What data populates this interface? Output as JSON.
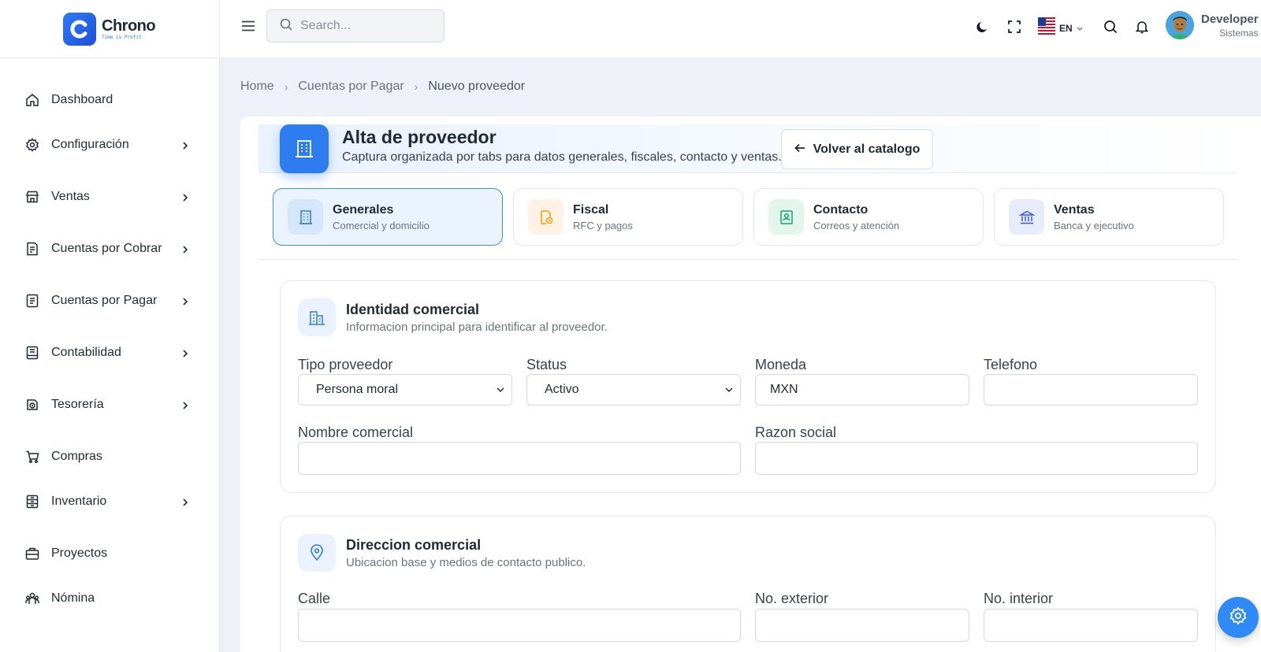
{
  "app": {
    "name": "Chrono",
    "tagline": "Time is Profit"
  },
  "topbar": {
    "search_placeholder": "Search...",
    "language": "EN",
    "user_name": "Developer",
    "user_role": "Sistemas"
  },
  "sidebar": {
    "items": [
      {
        "label": "Dashboard",
        "icon": "home-icon",
        "has_children": false
      },
      {
        "label": "Configuración",
        "icon": "gear-icon",
        "has_children": true
      },
      {
        "label": "Ventas",
        "icon": "store-icon",
        "has_children": true
      },
      {
        "label": "Cuentas por Cobrar",
        "icon": "receipt-icon",
        "has_children": true
      },
      {
        "label": "Cuentas por Pagar",
        "icon": "document-icon",
        "has_children": true
      },
      {
        "label": "Contabilidad",
        "icon": "ledger-icon",
        "has_children": true
      },
      {
        "label": "Tesorería",
        "icon": "coins-icon",
        "has_children": true
      },
      {
        "label": "Compras",
        "icon": "cart-icon",
        "has_children": false
      },
      {
        "label": "Inventario",
        "icon": "inventory-icon",
        "has_children": true
      },
      {
        "label": "Proyectos",
        "icon": "briefcase-icon",
        "has_children": false
      },
      {
        "label": "Nómina",
        "icon": "people-icon",
        "has_children": false
      }
    ]
  },
  "breadcrumb": {
    "home": "Home",
    "parent": "Cuentas por Pagar",
    "current": "Nuevo proveedor"
  },
  "header": {
    "title": "Alta de proveedor",
    "subtitle": "Captura organizada por tabs para datos generales, fiscales, contacto y ventas.",
    "back_label": "Volver al catalogo"
  },
  "tabs": [
    {
      "title": "Generales",
      "subtitle": "Comercial y domicilio",
      "active": true
    },
    {
      "title": "Fiscal",
      "subtitle": "RFC y pagos",
      "active": false
    },
    {
      "title": "Contacto",
      "subtitle": "Correos y atención",
      "active": false
    },
    {
      "title": "Ventas",
      "subtitle": "Banca y ejecutivo",
      "active": false
    }
  ],
  "identidad": {
    "title": "Identidad comercial",
    "subtitle": "Informacion principal para identificar al proveedor.",
    "tipo_label": "Tipo proveedor",
    "tipo_value": "Persona moral",
    "status_label": "Status",
    "status_value": "Activo",
    "moneda_label": "Moneda",
    "moneda_value": "MXN",
    "telefono_label": "Telefono",
    "telefono_value": "",
    "nombre_label": "Nombre comercial",
    "nombre_value": "",
    "razon_label": "Razon social",
    "razon_value": ""
  },
  "direccion": {
    "title": "Direccion comercial",
    "subtitle": "Ubicacion base y medios de contacto publico.",
    "calle_label": "Calle",
    "exterior_label": "No. exterior",
    "interior_label": "No. interior"
  },
  "colors": {
    "accent": "#2d7cf0",
    "sidebar_bg": "#ffffff",
    "page_bg": "#eef1f7"
  }
}
